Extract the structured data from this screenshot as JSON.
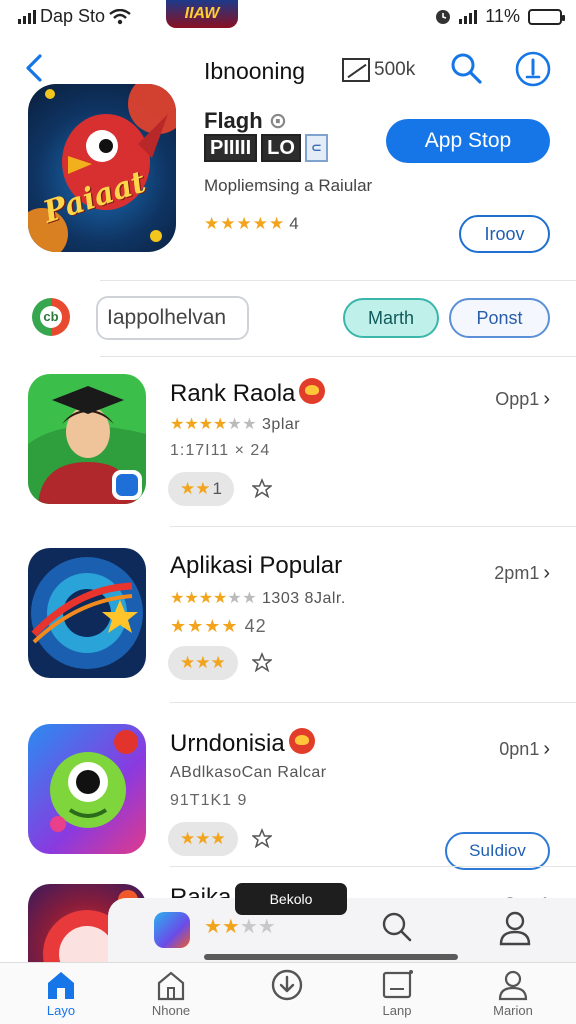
{
  "status_bar": {
    "carrier": "Dap Sto",
    "battery_text": "11%",
    "battery_level": 0.85
  },
  "top_badge": {
    "text": "IIAW"
  },
  "nav": {
    "title": "Ibnooning",
    "field_value": "500k"
  },
  "hero": {
    "title": "Flagh",
    "boxes": [
      "PIIIII",
      "LO"
    ],
    "chip": "⊂",
    "subtitle": "Mopliemsing a Raiular",
    "stars": "★★★★★",
    "rating": "4",
    "primary_button": "App Stop",
    "secondary_button": "Iroov",
    "icon_text": "Paiaat"
  },
  "filter": {
    "search_value": "Iappolhelvan",
    "pill_active": "Marth",
    "pill_inactive": "Ponst"
  },
  "apps": [
    {
      "title": "Rank Raola",
      "stars_on": "★★★★",
      "stars_off": "★★",
      "meta": "3plar",
      "meta2": "1:17I11 × 24",
      "chip_stars": "★★",
      "chip_num": "1",
      "open": "Opp1",
      "accent": "#2db84a"
    },
    {
      "title": "Aplikasi Popular",
      "stars_on": "★★★★",
      "stars_off": "★★",
      "meta": "1303 8Jalr.",
      "meta2_stars": "★★★★",
      "meta2": "42",
      "chip_stars": "★★★",
      "chip_num": "",
      "open": "2pm1",
      "accent": "#123d8a"
    },
    {
      "title": "Urndonisia",
      "subtitle": "ABdlkasoCan Ralcar",
      "meta2": "91T1K1 9",
      "chip_stars": "★★★",
      "chip_num": "",
      "open": "0pn1",
      "button": "SuIdiov",
      "accent": "#7a3ad6"
    }
  ],
  "last_app": {
    "title": "Raika",
    "open": "2pm1"
  },
  "tooltip": {
    "text": "Bekolo"
  },
  "mini_player": {
    "stars_on": "★★",
    "stars_off": "★★"
  },
  "tabs": [
    {
      "label": "Layo",
      "active": true
    },
    {
      "label": "Nhone",
      "active": false
    },
    {
      "label": "",
      "active": false
    },
    {
      "label": "Lanp",
      "active": false
    },
    {
      "label": "Marion",
      "active": false
    }
  ],
  "colors": {
    "accent": "#1676e8",
    "star": "#f2a51c",
    "teal": "#3ab6aa"
  }
}
